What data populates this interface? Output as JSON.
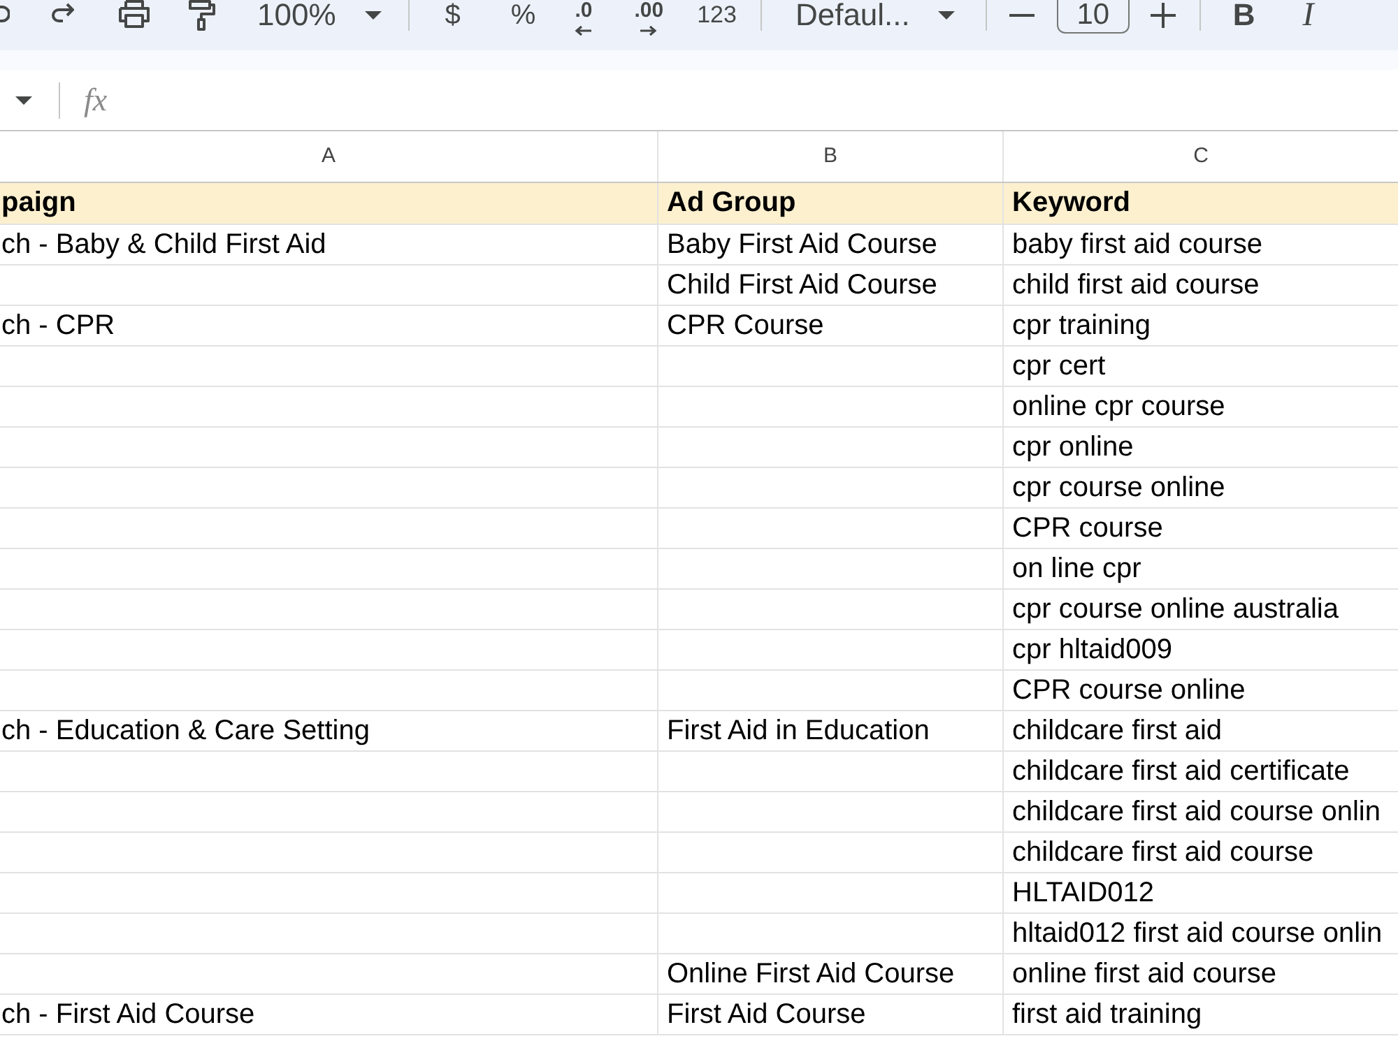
{
  "toolbar": {
    "zoom": "100%",
    "currency": "$",
    "percent": "%",
    "decrease_decimal": ".0",
    "increase_decimal": ".00",
    "number_format": "123",
    "font": "Defaul...",
    "font_size": "10",
    "bold": "B",
    "italic": "I"
  },
  "formula_bar": {
    "function_label": "fx"
  },
  "sheet": {
    "columns": [
      "A",
      "B",
      "C"
    ],
    "rows": [
      {
        "kind": "header",
        "a": "paign",
        "b": "Ad Group",
        "c": "Keyword"
      },
      {
        "kind": "data",
        "a": "ch - Baby & Child First Aid",
        "b": "Baby First Aid Course",
        "c": "baby first aid course"
      },
      {
        "kind": "data",
        "b": "Child First Aid Course",
        "c": "child first aid course"
      },
      {
        "kind": "data",
        "a": "ch - CPR",
        "b": "CPR Course",
        "c": "cpr training"
      },
      {
        "kind": "data",
        "c": "cpr cert"
      },
      {
        "kind": "data",
        "c": "online cpr course"
      },
      {
        "kind": "data",
        "c": "cpr online"
      },
      {
        "kind": "data",
        "c": "cpr course online"
      },
      {
        "kind": "data",
        "c": "CPR course"
      },
      {
        "kind": "data",
        "c": "on line cpr"
      },
      {
        "kind": "data",
        "c": "cpr course online australia"
      },
      {
        "kind": "data",
        "c": "cpr hltaid009"
      },
      {
        "kind": "data",
        "c": "CPR course online"
      },
      {
        "kind": "data",
        "a": "ch - Education & Care Setting",
        "b": "First Aid in Education",
        "c": "childcare first aid"
      },
      {
        "kind": "data",
        "c": "childcare first aid certificate"
      },
      {
        "kind": "data",
        "c": "childcare first aid course onlin"
      },
      {
        "kind": "data",
        "c": "childcare first aid course"
      },
      {
        "kind": "data",
        "c": "HLTAID012"
      },
      {
        "kind": "data",
        "c": "hltaid012 first aid course onlin"
      },
      {
        "kind": "data",
        "b": "Online First Aid Course",
        "c": "online first aid course"
      },
      {
        "kind": "data",
        "a": "ch - First Aid Course",
        "b": "First Aid Course",
        "c": "first aid training"
      }
    ]
  }
}
